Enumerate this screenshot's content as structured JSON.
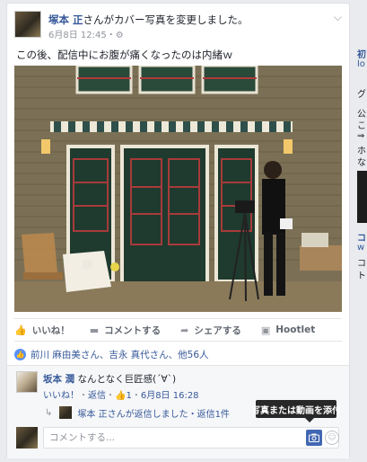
{
  "post": {
    "author": "塚本 正",
    "action_text": "さんがカバー写真を変更しました。",
    "date": "6月8日 12:45",
    "privacy_sep": "・",
    "privacy_icon": "gear-icon",
    "text": "この後、配信中にお腹が痛くなったのは内緒ｗ"
  },
  "actions": {
    "like": "いいね！",
    "comment": "コメントする",
    "share": "シェアする",
    "hootlet": "Hootlet"
  },
  "likes": {
    "text": "前川 麻由美さん、吉永 真代さん、他56人"
  },
  "comment": {
    "author": "坂本 潤",
    "text": "なんとなく巨匠感(´∀`)",
    "like_link": "いいね！",
    "sep1": "・",
    "reply_link": "返信",
    "sep2": "・",
    "like_count": "1",
    "sep3": "・",
    "date": "6月8日 16:28"
  },
  "reply_summary": {
    "text": "塚本 正さんが返信しました・返信1件"
  },
  "composer": {
    "placeholder": "コメントする..."
  },
  "tooltip": {
    "text": "写真または動画を添付"
  },
  "right_column": {
    "items": [
      "初",
      "lo",
      "グ",
      "公",
      "こ",
      "⇒",
      "ホ",
      "な",
      "コ",
      "w",
      "コ",
      "ト"
    ]
  }
}
